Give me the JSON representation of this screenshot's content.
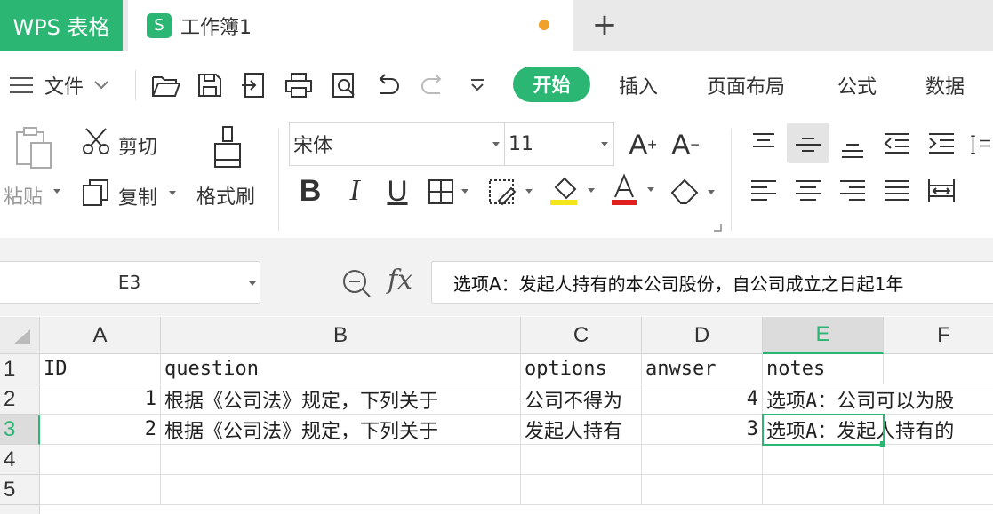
{
  "titlebar": {
    "app_name": "WPS 表格",
    "doc_icon_letter": "S",
    "doc_title": "工作簿1",
    "new_tab_symbol": "+"
  },
  "menu": {
    "file_label": "文件",
    "tabs": [
      "开始",
      "插入",
      "页面布局",
      "公式",
      "数据"
    ]
  },
  "ribbon": {
    "paste_label": "粘贴",
    "cut_label": "剪切",
    "copy_label": "复制",
    "format_painter_label": "格式刷",
    "font_name": "宋体",
    "font_size": "11",
    "grow_font": "A",
    "shrink_font": "A",
    "bold": "B",
    "italic": "I",
    "underline": "U",
    "font_color_letter": "A",
    "font_color": "#e02020",
    "highlight_color": "#f5e51c"
  },
  "formula_bar": {
    "name_box": "E3",
    "fx_label": "fx",
    "content": "选项A：发起人持有的本公司股份，自公司成立之日起1年"
  },
  "sheet": {
    "columns": [
      "A",
      "B",
      "C",
      "D",
      "E",
      "F"
    ],
    "rows": [
      "1",
      "2",
      "3",
      "4",
      "5"
    ],
    "selected_cell": "E3",
    "cells": {
      "A1": "ID",
      "B1": "question",
      "C1": "options",
      "D1": "anwser",
      "E1": "notes",
      "A2": "1",
      "B2": "根据《公司法》规定，下列关于",
      "C2": "公司不得为",
      "D2": "4",
      "E2": "选项A：公司可以为股",
      "A3": "2",
      "B3": "根据《公司法》规定，下列关于",
      "C3": "发起人持有",
      "D3": "3",
      "E3": "选项A：发起人持有的"
    }
  },
  "colors": {
    "accent": "#2bb673"
  }
}
